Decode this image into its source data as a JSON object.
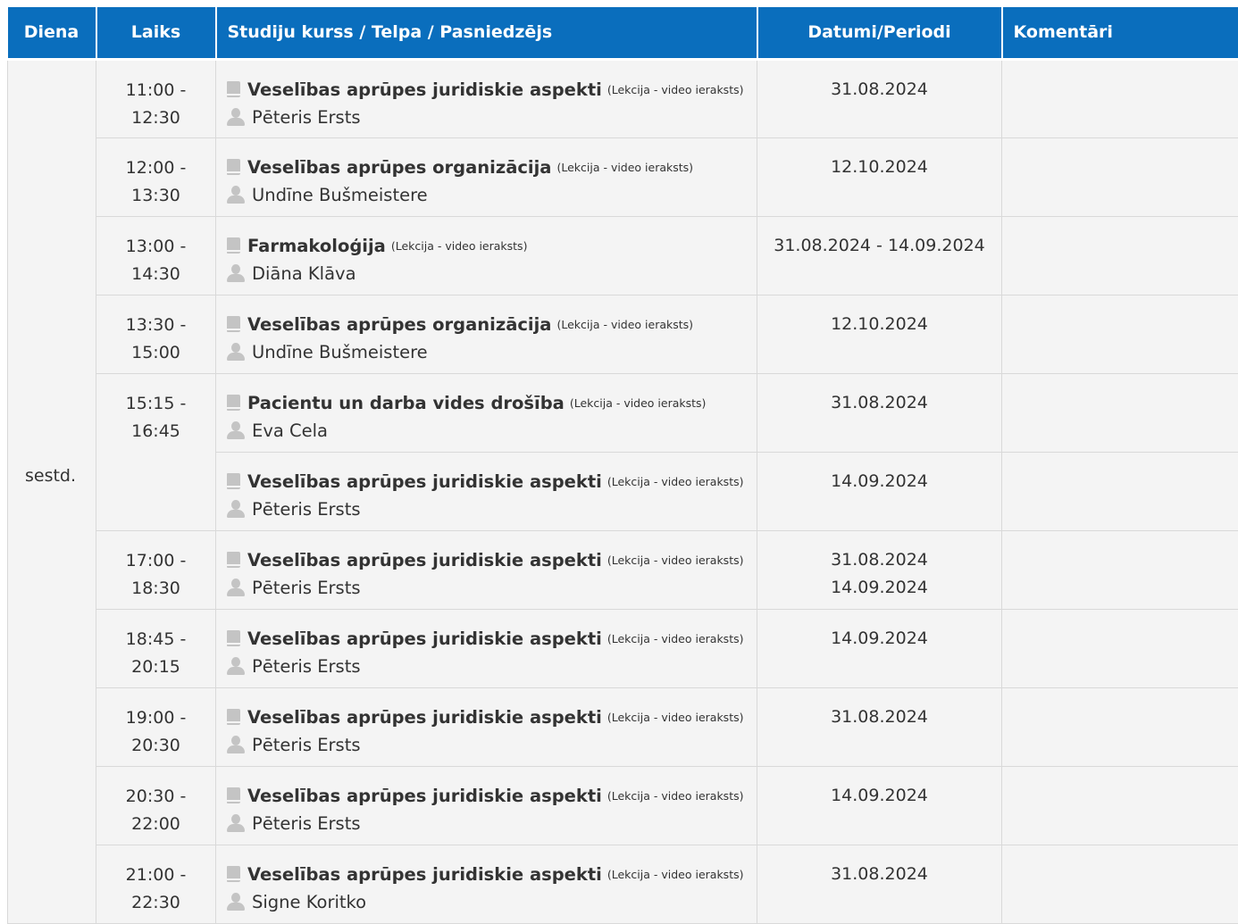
{
  "headers": {
    "day": "Diena",
    "time": "Laiks",
    "course": "Studiju kurss / Telpa / Pasniedzējs",
    "dates": "Datumi/Periodi",
    "comments": "Komentāri"
  },
  "day_label": "sestd.",
  "rows": [
    {
      "time_start": "11:00 -",
      "time_end": "12:30",
      "course": "Veselības aprūpes juridiskie aspekti",
      "type": "(Lekcija - video ieraksts)",
      "lecturer": "Pēteris Ersts",
      "dates": [
        "31.08.2024"
      ],
      "comment": ""
    },
    {
      "time_start": "12:00 -",
      "time_end": "13:30",
      "course": "Veselības aprūpes organizācija",
      "type": "(Lekcija - video ieraksts)",
      "lecturer": "Undīne Bušmeistere",
      "dates": [
        "12.10.2024"
      ],
      "comment": ""
    },
    {
      "time_start": "13:00 -",
      "time_end": "14:30",
      "course": "Farmakoloģija",
      "type": "(Lekcija - video ieraksts)",
      "lecturer": "Diāna Klāva",
      "dates": [
        "31.08.2024 - 14.09.2024"
      ],
      "comment": ""
    },
    {
      "time_start": "13:30 -",
      "time_end": "15:00",
      "course": "Veselības aprūpes organizācija",
      "type": "(Lekcija - video ieraksts)",
      "lecturer": "Undīne Bušmeistere",
      "dates": [
        "12.10.2024"
      ],
      "comment": ""
    },
    {
      "time_start": "15:15 -",
      "time_end": "16:45",
      "course": "Pacientu un darba vides drošība",
      "type": "(Lekcija - video ieraksts)",
      "lecturer": "Eva Cela",
      "dates": [
        "31.08.2024"
      ],
      "comment": ""
    },
    {
      "time_start": "",
      "time_end": "",
      "course": "Veselības aprūpes juridiskie aspekti",
      "type": "(Lekcija - video ieraksts)",
      "lecturer": "Pēteris Ersts",
      "dates": [
        "14.09.2024"
      ],
      "comment": ""
    },
    {
      "time_start": "17:00 -",
      "time_end": "18:30",
      "course": "Veselības aprūpes juridiskie aspekti",
      "type": "(Lekcija - video ieraksts)",
      "lecturer": "Pēteris Ersts",
      "dates": [
        "31.08.2024",
        "14.09.2024"
      ],
      "comment": ""
    },
    {
      "time_start": "18:45 -",
      "time_end": "20:15",
      "course": "Veselības aprūpes juridiskie aspekti",
      "type": "(Lekcija - video ieraksts)",
      "lecturer": "Pēteris Ersts",
      "dates": [
        "14.09.2024"
      ],
      "comment": ""
    },
    {
      "time_start": "19:00 -",
      "time_end": "20:30",
      "course": "Veselības aprūpes juridiskie aspekti",
      "type": "(Lekcija - video ieraksts)",
      "lecturer": "Pēteris Ersts",
      "dates": [
        "31.08.2024"
      ],
      "comment": ""
    },
    {
      "time_start": "20:30 -",
      "time_end": "22:00",
      "course": "Veselības aprūpes juridiskie aspekti",
      "type": "(Lekcija - video ieraksts)",
      "lecturer": "Pēteris Ersts",
      "dates": [
        "14.09.2024"
      ],
      "comment": ""
    },
    {
      "time_start": "21:00 -",
      "time_end": "22:30",
      "course": "Veselības aprūpes juridiskie aspekti",
      "type": "(Lekcija - video ieraksts)",
      "lecturer": "Signe Koritko",
      "dates": [
        "31.08.2024"
      ],
      "comment": ""
    }
  ],
  "icons": {
    "course": "book-icon",
    "lecturer": "user-icon"
  },
  "colors": {
    "header_bg": "#0a6ebd",
    "header_text": "#ffffff",
    "cell_bg": "#f4f4f4",
    "border": "#d9d9d9",
    "icon": "#c4c4c4"
  }
}
